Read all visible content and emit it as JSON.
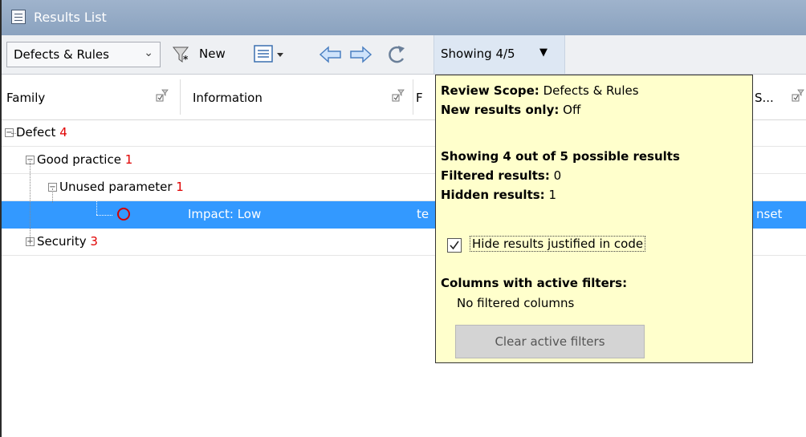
{
  "window": {
    "title": "Results List",
    "icon": "list-icon"
  },
  "toolbar": {
    "scope_value": "Defects & Rules",
    "new_label": "New",
    "showing_label": "Showing 4/5"
  },
  "columns": [
    {
      "label": "Family"
    },
    {
      "label": "Information"
    },
    {
      "label": "F"
    },
    {
      "label": "S..."
    }
  ],
  "tree": {
    "defect": {
      "label": "Defect",
      "count": "4"
    },
    "good_practice": {
      "label": "Good practice",
      "count": "1"
    },
    "unused_parameter": {
      "label": "Unused parameter",
      "count": "1"
    },
    "result_row": {
      "information": "Impact: Low",
      "f_partial": "te",
      "s_partial": "nset"
    },
    "security": {
      "label": "Security",
      "count": "3"
    }
  },
  "popup": {
    "scope_label": "Review Scope:",
    "scope_value": "Defects & Rules",
    "new_only_label": "New results only:",
    "new_only_value": "Off",
    "showing_summary": "Showing 4 out of 5 possible results",
    "filtered_label": "Filtered results:",
    "filtered_value": "0",
    "hidden_label": "Hidden results:",
    "hidden_value": "1",
    "hide_justified_label": "Hide results justified in code",
    "hide_justified_checked": true,
    "active_filters_heading": "Columns with active filters:",
    "no_filtered": "No filtered columns",
    "clear_button": "Clear active filters"
  },
  "colors": {
    "selection": "#3399ff",
    "count_red": "#e00000",
    "popup_bg": "#ffffcc",
    "titlebar": "#8aa2bf"
  }
}
